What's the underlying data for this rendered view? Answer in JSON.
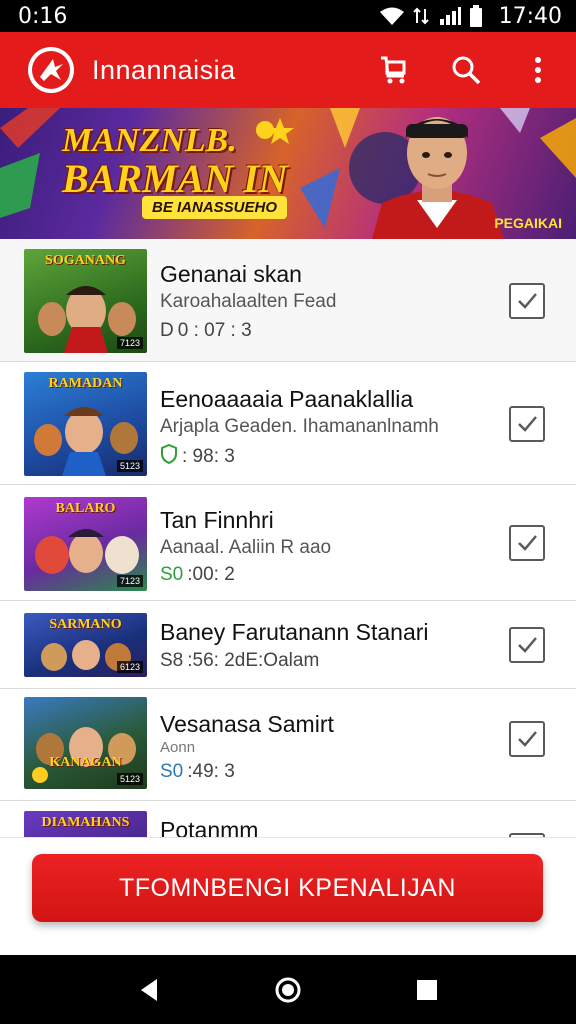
{
  "status_bar": {
    "left_text": "0:16",
    "time": "17:40",
    "icons": [
      "wifi-icon",
      "signal-icon",
      "cell-signal-icon",
      "battery-icon"
    ]
  },
  "app_bar": {
    "title": "Innannaisia",
    "logo": "app-logo-icon",
    "actions": [
      "cart-icon",
      "search-icon",
      "more-vert-icon"
    ],
    "color": "#e31b1b"
  },
  "banner": {
    "title_line1": "MANZNLB.",
    "title_line2": "BARMAN IN",
    "subtitle": "BE IANASSUEHO",
    "tag": "PEGAIKAI"
  },
  "list": {
    "items": [
      {
        "title": "Genanai skan",
        "subtitle": "Karoahalaalten Fead",
        "meta_prefix": "D",
        "meta": "0 : 07 : 3",
        "thumb_title": "SOGANANG",
        "thumb_badge": "7123",
        "checked": true
      },
      {
        "title": "Eenoaaaaia Paanaklallia",
        "subtitle": "Arjapla Geaden. Ihamananlnamh",
        "meta_prefix": "",
        "meta": ": 98: 3",
        "thumb_title": "RAMADAN",
        "thumb_badge": "5123",
        "checked": true
      },
      {
        "title": "Tan Finnhri",
        "subtitle": "Aanaal. Aaliin R aao",
        "meta_prefix": "S0",
        "meta": ":00: 2",
        "thumb_title": "BALARO",
        "thumb_badge": "7123",
        "checked": true
      },
      {
        "title": "Baney Farutanann Stanari",
        "subtitle": "",
        "meta_prefix": "S8",
        "meta": ":56: 2dE:Oalam",
        "thumb_title": "SARMANO",
        "thumb_badge": "6123",
        "checked": true
      },
      {
        "title": "Vesanasa Samirt",
        "subtitle": "Aonn",
        "meta_prefix": "S0",
        "meta": ":49: 3",
        "thumb_title": "KANAGAN",
        "thumb_badge": "5123",
        "checked": true
      },
      {
        "title": "Potanmm",
        "subtitle": "",
        "meta_prefix": "",
        "meta": "",
        "thumb_title": "DIAMAHANS",
        "thumb_badge": "",
        "checked": true
      }
    ]
  },
  "cta": {
    "label": "TFOMNBENGI KPENALIJAN"
  },
  "nav_bar": {
    "buttons": [
      "back-icon",
      "home-icon",
      "recents-icon"
    ]
  }
}
